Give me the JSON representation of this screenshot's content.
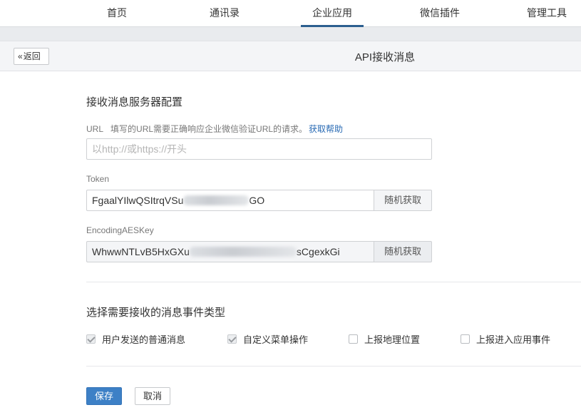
{
  "nav": {
    "tabs": [
      {
        "label": "首页"
      },
      {
        "label": "通讯录"
      },
      {
        "label": "企业应用"
      },
      {
        "label": "微信插件"
      },
      {
        "label": "管理工具"
      }
    ],
    "active": "企业应用"
  },
  "header": {
    "back_label": "返回",
    "title": "API接收消息"
  },
  "server_config": {
    "title": "接收消息服务器配置",
    "url": {
      "label": "URL",
      "hint": "填写的URL需要正确响应企业微信验证URL的请求。",
      "help_link": "获取帮助",
      "placeholder": "以http://或https://开头"
    },
    "token": {
      "label": "Token",
      "value_prefix": "FgaalYIlwQSItrqVSu",
      "value_suffix": "GO",
      "random_label": "随机获取"
    },
    "aes": {
      "label": "EncodingAESKey",
      "value_prefix": "WhwwNTLvB5HxGXu",
      "value_suffix": "sCgexkGi",
      "random_label": "随机获取"
    }
  },
  "event_types": {
    "title": "选择需要接收的消息事件类型",
    "options": [
      {
        "label": "用户发送的普通消息",
        "checked": true,
        "disabled": true
      },
      {
        "label": "自定义菜单操作",
        "checked": true,
        "disabled": true
      },
      {
        "label": "上报地理位置",
        "checked": false,
        "disabled": false
      },
      {
        "label": "上报进入应用事件",
        "checked": false,
        "disabled": false
      }
    ]
  },
  "actions": {
    "save_label": "保存",
    "cancel_label": "取消"
  },
  "colors": {
    "primary": "#3d80c6",
    "link": "#2a6bb4",
    "active_tab": "#2c5f8f"
  }
}
